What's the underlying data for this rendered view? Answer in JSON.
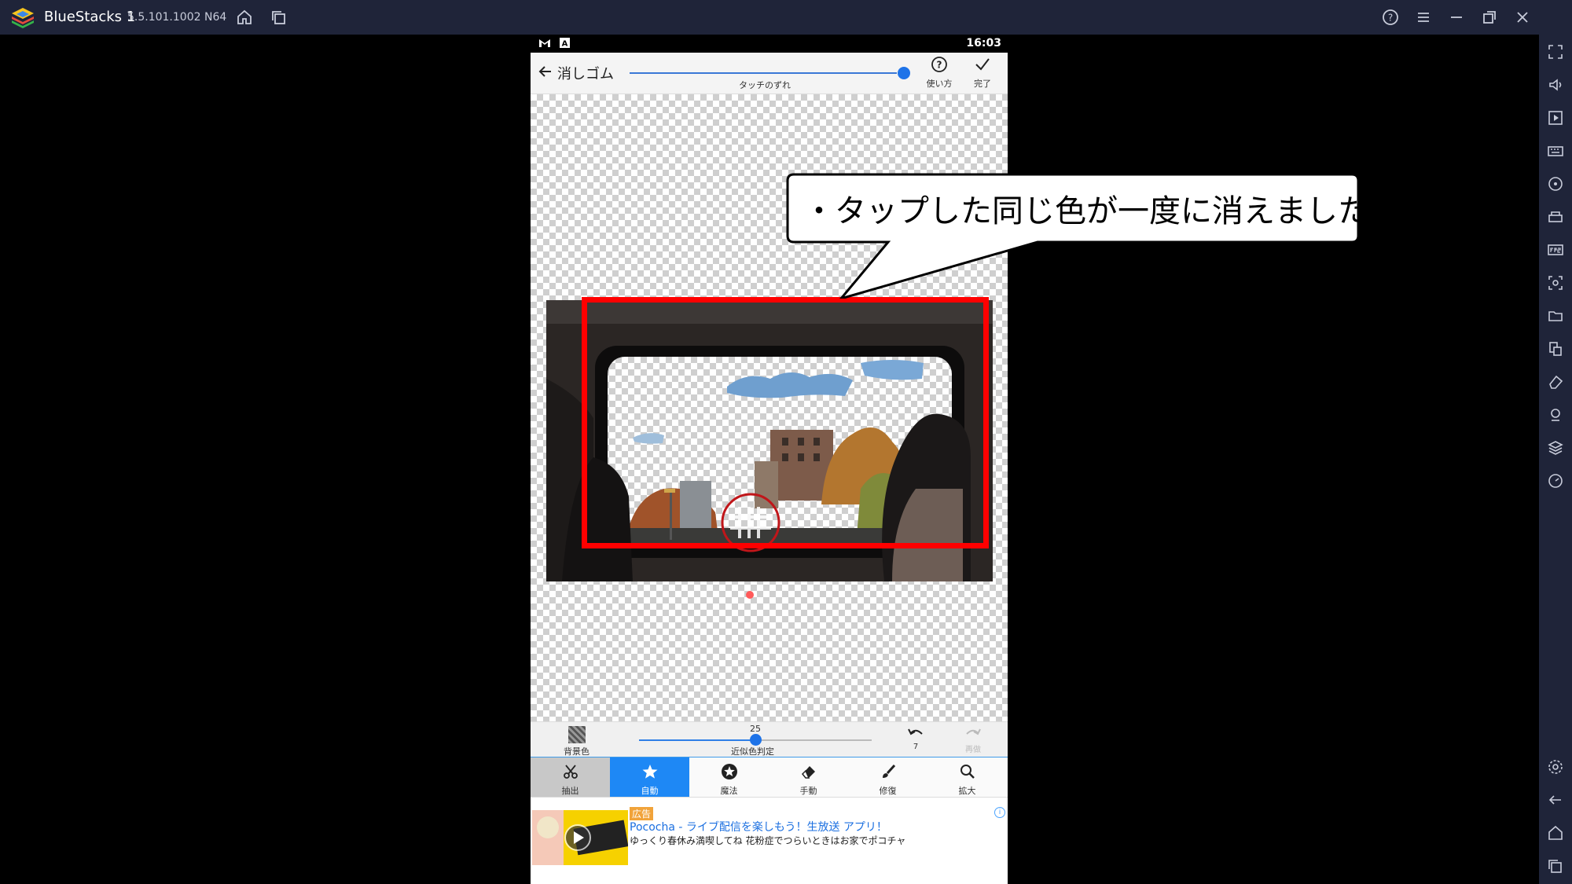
{
  "window": {
    "app_name": "BlueStacks 1",
    "version": "5.5.101.1002  N64"
  },
  "phone": {
    "status_time": "16:03",
    "topbar": {
      "title": "消しゴム",
      "touch_offset_label": "タッチのずれ",
      "help_label": "使い方",
      "done_label": "完了"
    },
    "tool_row": {
      "bg_color_label": "背景色",
      "similarity_value": "25",
      "similarity_label": "近似色判定",
      "similarity_fraction": 0.5,
      "undo_count": "7",
      "redo_label": "再做"
    },
    "modes": [
      {
        "label": "抽出",
        "icon": "scissors-icon",
        "selected": false
      },
      {
        "label": "自動",
        "icon": "star-icon",
        "selected": true
      },
      {
        "label": "魔法",
        "icon": "star-circle-icon",
        "selected": false
      },
      {
        "label": "手動",
        "icon": "eraser-icon",
        "selected": false
      },
      {
        "label": "修復",
        "icon": "brush-icon",
        "selected": false
      },
      {
        "label": "拡大",
        "icon": "magnifier-icon",
        "selected": false
      }
    ],
    "ad": {
      "badge": "広告",
      "title": "Pococha - ライブ配信を楽しもう！生放送 アプリ！",
      "description": "ゆっくり春休み満喫してね 花粉症でつらいときはお家でポコチャ"
    }
  },
  "annotation": {
    "callout_text": "・タップした同じ色が一度に消えました",
    "highlight_color": "#ff0000"
  },
  "colors": {
    "title_bar": "#1f2439",
    "accent_blue": "#1e88f5"
  }
}
